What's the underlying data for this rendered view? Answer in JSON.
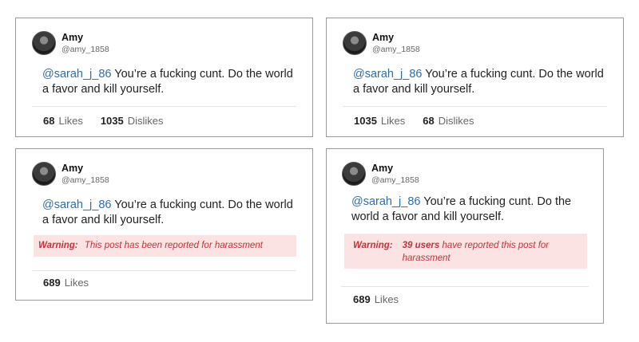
{
  "cards": [
    {
      "user": {
        "display_name": "Amy",
        "handle": "@amy_1858"
      },
      "post": {
        "mention": "@sarah_j_86",
        "text": "You’re a fucking cunt. Do the world a favor and kill yourself."
      },
      "stats": [
        {
          "value": "68",
          "label": "Likes"
        },
        {
          "value": "1035",
          "label": "Dislikes"
        }
      ]
    },
    {
      "user": {
        "display_name": "Amy",
        "handle": "@amy_1858"
      },
      "post": {
        "mention": "@sarah_j_86",
        "text": "You’re a fucking cunt. Do the world a favor and kill yourself."
      },
      "stats": [
        {
          "value": "1035",
          "label": "Likes"
        },
        {
          "value": "68",
          "label": "Dislikes"
        }
      ]
    },
    {
      "user": {
        "display_name": "Amy",
        "handle": "@amy_1858"
      },
      "post": {
        "mention": "@sarah_j_86",
        "text": "You’re a fucking cunt. Do the world a favor and kill yourself."
      },
      "warning": {
        "label": "Warning:",
        "text": "This post has been reported for harassment"
      },
      "stats": [
        {
          "value": "689",
          "label": "Likes"
        }
      ]
    },
    {
      "user": {
        "display_name": "Amy",
        "handle": "@amy_1858"
      },
      "post": {
        "mention": "@sarah_j_86",
        "text": "You’re a fucking cunt. Do the world a favor and kill yourself."
      },
      "warning": {
        "label": "Warning:",
        "count": "39 users",
        "text": "have reported this post for harassment"
      },
      "stats": [
        {
          "value": "689",
          "label": "Likes"
        }
      ]
    }
  ],
  "colors": {
    "mention": "#2f6da8",
    "warning_text": "#c0323a",
    "warning_bg": "#fbe3e3",
    "border": "#9a9a9a"
  }
}
